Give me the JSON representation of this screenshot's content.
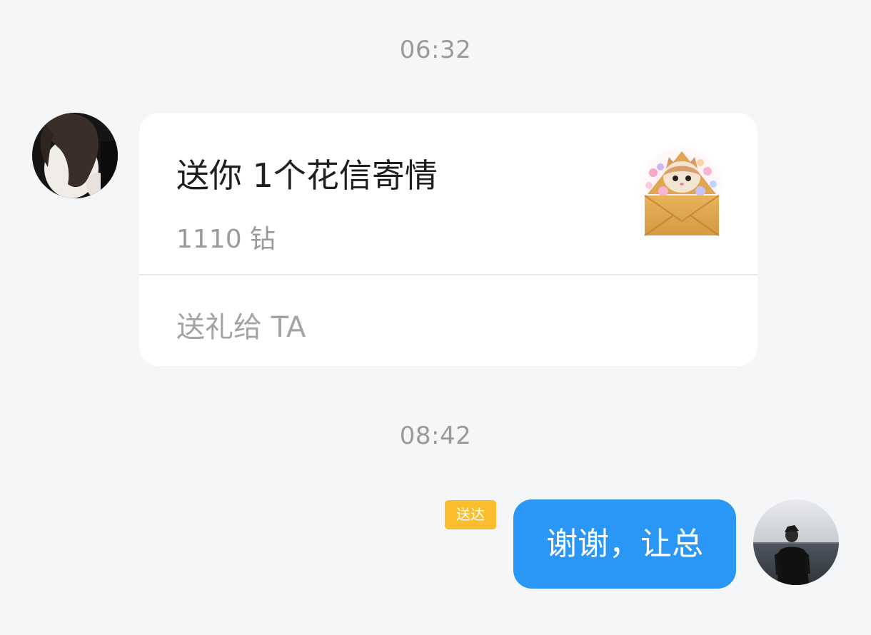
{
  "chat": {
    "timestamps": [
      "06:32",
      "08:42"
    ],
    "gift_message": {
      "title": "送你 1个花信寄情",
      "price": "1110 钻",
      "action_label": "送礼给 TA",
      "gift_icon": "cat-in-flower-envelope"
    },
    "sent_message": {
      "status": "送达",
      "text": "谢谢，让总"
    },
    "avatars": {
      "contact": "woman-dark-hair-avatar",
      "self": "man-seaside-avatar"
    }
  },
  "colors": {
    "background": "#f5f6f8",
    "bubble_blue": "#2a97f6",
    "delivered_badge": "#f9bd2d",
    "card": "#ffffff",
    "muted_text": "#9a9a9a"
  }
}
